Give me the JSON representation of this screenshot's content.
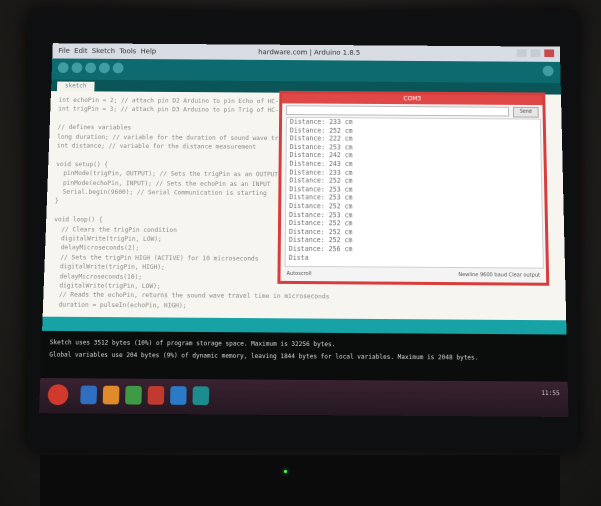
{
  "window": {
    "title": "hardware.com | Arduino 1.8.5",
    "menu": "File  Edit  Sketch  Tools  Help"
  },
  "tab": {
    "label": "sketch"
  },
  "editor": {
    "lines": [
      "int echoPin = 2; // attach pin D2 Arduino to pin Echo of HC-SR04",
      "int trigPin = 3; // attach pin D3 Arduino to pin Trig of HC-SR04",
      "",
      "// defines variables",
      "long duration; // variable for the duration of sound wave travel",
      "int distance; // variable for the distance measurement",
      "",
      "void setup() {",
      "  pinMode(trigPin, OUTPUT); // Sets the trigPin as an OUTPUT",
      "  pinMode(echoPin, INPUT); // Sets the echoPin as an INPUT",
      "  Serial.begin(9600); // Serial Communication is starting",
      "}",
      "",
      "void loop() {",
      "  // Clears the trigPin condition",
      "  digitalWrite(trigPin, LOW);",
      "  delayMicroseconds(2);",
      "  // Sets the trigPin HIGH (ACTIVE) for 10 microseconds",
      "  digitalWrite(trigPin, HIGH);",
      "  delayMicroseconds(10);",
      "  digitalWrite(trigPin, LOW);",
      "  // Reads the echoPin, returns the sound wave travel time in microseconds",
      "  duration = pulseIn(echoPin, HIGH);"
    ]
  },
  "console": {
    "lines": [
      "Sketch uses 3512 bytes (10%) of program storage space. Maximum is 32256 bytes.",
      "Global variables use 204 bytes (9%) of dynamic memory, leaving 1844 bytes for local variables. Maximum is 2048 bytes."
    ]
  },
  "serial_monitor": {
    "title": "COM3",
    "send_label": "Send",
    "output": [
      "Distance: 233 cm",
      "Distance: 252 cm",
      "Distance: 222 cm",
      "Distance: 253 cm",
      "Distance: 242 cm",
      "Distance: 243 cm",
      "Distance: 233 cm",
      "Distance: 252 cm",
      "Distance: 253 cm",
      "Distance: 253 cm",
      "Distance: 252 cm",
      "Distance: 253 cm",
      "Distance: 252 cm",
      "Distance: 252 cm",
      "Distance: 252 cm",
      "Distance: 256 cm",
      "Dista"
    ],
    "autoscroll_label": "Autoscroll",
    "footer_right": "Newline   9600 baud   Clear output"
  },
  "taskbar": {
    "tray": "11:55"
  },
  "colors": {
    "toolbar": "#0d6a6e",
    "console_bar": "#17a2a6",
    "serial_border": "#d83d3d"
  }
}
